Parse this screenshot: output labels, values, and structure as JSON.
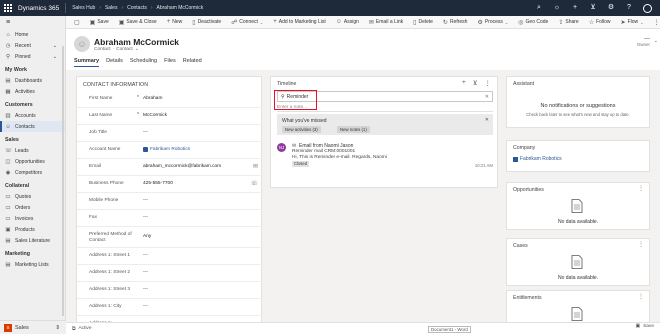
{
  "topbar": {
    "app_name": "Dynamics 365",
    "app_area": "Sales Hub",
    "crumb_1": "Sales",
    "crumb_2": "Contacts",
    "crumb_3": "Abraham McCormick"
  },
  "commands": [
    "Save",
    "Save & Close",
    "New",
    "Deactivate",
    "Connect",
    "Add to Marketing List",
    "Assign",
    "Email a Link",
    "Delete",
    "Refresh",
    "Process",
    "Geo Code",
    "Share",
    "Follow",
    "Flow"
  ],
  "sitemap": {
    "items_top": [
      "Home",
      "Recent",
      "Pinned"
    ],
    "group_my_work": "My Work",
    "my_work": [
      "Dashboards",
      "Activities"
    ],
    "group_customers": "Customers",
    "customers": [
      "Accounts",
      "Contacts"
    ],
    "group_sales": "Sales",
    "sales": [
      "Leads",
      "Opportunities",
      "Competitors"
    ],
    "group_collateral": "Collateral",
    "collateral": [
      "Quotes",
      "Orders",
      "Invoices",
      "Products",
      "Sales Literature"
    ],
    "group_marketing": "Marketing",
    "marketing": [
      "Marketing Lists"
    ],
    "area_badge": "S",
    "area_label": "Sales"
  },
  "header": {
    "name": "Abraham McCormick",
    "entity": "Contact",
    "form": "Contact",
    "owner_value": "---",
    "owner_label": "Owner"
  },
  "tabs": [
    "Summary",
    "Details",
    "Scheduling",
    "Files",
    "Related"
  ],
  "contact_info": {
    "title": "CONTACT INFORMATION",
    "fields": [
      {
        "label": "First Name",
        "value": "Abraham"
      },
      {
        "label": "Last Name",
        "value": "McCormick"
      },
      {
        "label": "Job Title",
        "value": "---"
      },
      {
        "label": "Account Name",
        "value": "Fabrikam Robotics"
      },
      {
        "label": "Email",
        "value": "abraham_mccormick@fabrikam.com"
      },
      {
        "label": "Business Phone",
        "value": "425-555-7700"
      },
      {
        "label": "Mobile Phone",
        "value": "---"
      },
      {
        "label": "Fax",
        "value": "---"
      },
      {
        "label": "Preferred Method of Contact",
        "value": "Any"
      },
      {
        "label": "Address 1: Street 1",
        "value": "---"
      },
      {
        "label": "Address 1: Street 2",
        "value": "---"
      },
      {
        "label": "Address 1: Street 3",
        "value": "---"
      },
      {
        "label": "Address 1: City",
        "value": "---"
      },
      {
        "label": "Address 1: State/Province",
        "value": "---"
      }
    ]
  },
  "timeline": {
    "title": "Timeline",
    "search_value": "Reminder",
    "note_placeholder": "Enter a note...",
    "missed_title": "What you've missed",
    "chip_activities": "New activities (3)",
    "chip_notes": "New notes (1)",
    "item": {
      "avatar": "NJ",
      "line1": "Email from Naomi Jason",
      "line2": "Reminder mail CRM:0001001",
      "line3": "Hi,   This is Reminder e-mail.   Regards, Naomi",
      "status": "Closed",
      "time": "10:21 AM"
    }
  },
  "assistant": {
    "title": "Assistant",
    "headline": "No notifications or suggestions",
    "sub": "Check back later to see what's new and stay up to date."
  },
  "company": {
    "label": "Company",
    "value": "Fabrikam Robotics"
  },
  "opportunities": {
    "title": "Opportunities",
    "empty": "No data available."
  },
  "cases": {
    "title": "Cases",
    "empty": "No data available."
  },
  "entitlements": {
    "title": "Entitlements"
  },
  "status": {
    "state": "Active",
    "doc_pill": "Document1 - Word",
    "save_label": "Save"
  }
}
